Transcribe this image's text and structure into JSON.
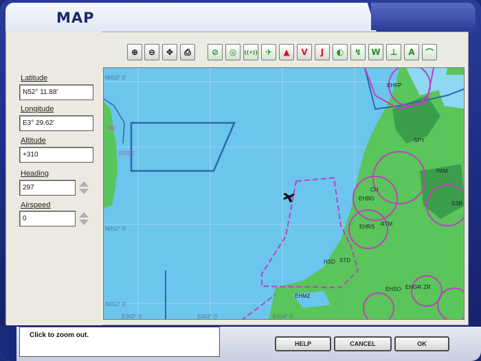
{
  "window": {
    "title": "MAP"
  },
  "fields": {
    "latitude": {
      "label": "Latitude",
      "value": "N52° 11.88'"
    },
    "longitude": {
      "label": "Longitude",
      "value": "E3° 29.62'"
    },
    "altitude": {
      "label": "Altitude",
      "value": "+310"
    },
    "heading": {
      "label": "Heading",
      "value": "297"
    },
    "airspeed": {
      "label": "Airspeed",
      "value": "0"
    }
  },
  "toolbar": {
    "view_tools": [
      {
        "name": "zoom-in-icon",
        "glyph": "⊕"
      },
      {
        "name": "zoom-out-icon",
        "glyph": "⊖"
      },
      {
        "name": "pan-icon",
        "glyph": "✥"
      },
      {
        "name": "print-icon",
        "glyph": "⎙"
      }
    ],
    "layer_tools": [
      {
        "name": "vor-icon",
        "glyph": "⊘"
      },
      {
        "name": "ndb-icon",
        "glyph": "◎"
      },
      {
        "name": "ils-icon",
        "glyph": "((•))"
      },
      {
        "name": "approach-icon",
        "glyph": "✈"
      },
      {
        "name": "intersection-icon",
        "glyph": "▲"
      },
      {
        "name": "victor-airway-icon",
        "glyph": "V"
      },
      {
        "name": "jet-airway-icon",
        "glyph": "J"
      },
      {
        "name": "terrain-icon",
        "glyph": "◐"
      },
      {
        "name": "route-icon",
        "glyph": "↯"
      },
      {
        "name": "waypoint-icon",
        "glyph": "W"
      },
      {
        "name": "airport-icon",
        "glyph": "⊥"
      },
      {
        "name": "airspace-icon",
        "glyph": "A"
      },
      {
        "name": "boundary-icon",
        "glyph": "⌒"
      }
    ]
  },
  "map": {
    "grid_labels": {
      "n053": "N053° 0'",
      "n052": "N052° 0'",
      "n051": "N051° 0'",
      "e002": "E002° 0'",
      "e003": "E003° 0'",
      "e004": "E004° 0'"
    },
    "places": [
      "EHFP",
      "SPY",
      "PAM",
      "SSB",
      "EGSE",
      "ND",
      "CH",
      "EHBG",
      "EHRS",
      "RTM",
      "EHSO",
      "HSD",
      "STD",
      "EHMZ",
      "EHGR",
      "ZR"
    ],
    "colors": {
      "sea": "#6cc5ec",
      "land": "#5ac55a",
      "land_dark": "#3a9e4a",
      "airspace_blue": "#2a6aa8",
      "airspace_magenta": "#c040c0"
    }
  },
  "status": {
    "text": "Click to zoom out."
  },
  "buttons": {
    "help": "HELP",
    "cancel": "CANCEL",
    "ok": "OK"
  }
}
